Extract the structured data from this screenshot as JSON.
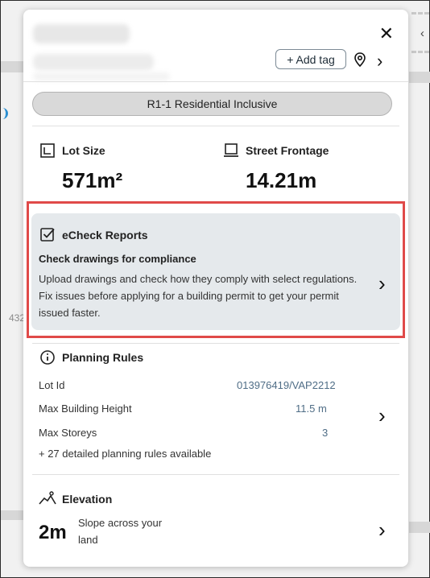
{
  "panel": {
    "add_tag_label": "+ Add tag",
    "close_label": "✕",
    "zone_label": "R1-1 Residential Inclusive"
  },
  "map": {
    "side_label": "432"
  },
  "stats": {
    "lot_size": {
      "label": "Lot Size",
      "value": "571m²",
      "icon": "lot-size-icon"
    },
    "street_frontage": {
      "label": "Street Frontage",
      "value": "14.21m",
      "icon": "street-frontage-icon"
    }
  },
  "echeck": {
    "title": "eCheck Reports",
    "subtitle": "Check drawings for compliance",
    "description": "Upload drawings and check how they comply with select regulations. Fix issues before applying for a building permit to get your permit issued faster.",
    "icon": "checkbox-icon"
  },
  "planning": {
    "title": "Planning Rules",
    "icon": "info-icon",
    "rows": [
      {
        "label": "Lot Id",
        "value": "013976419/VAP2212"
      },
      {
        "label": "Max Building Height",
        "value": "11.5 m"
      },
      {
        "label": "Max Storeys",
        "value": "3"
      }
    ],
    "more": "+ 27 detailed planning rules available"
  },
  "elevation": {
    "title": "Elevation",
    "icon": "terrain-icon",
    "value": "2m",
    "description": "Slope across your land"
  },
  "colors": {
    "accent_outline": "#e04a49",
    "link_value": "#4f6d86",
    "card_bg": "#e5e9ec"
  }
}
